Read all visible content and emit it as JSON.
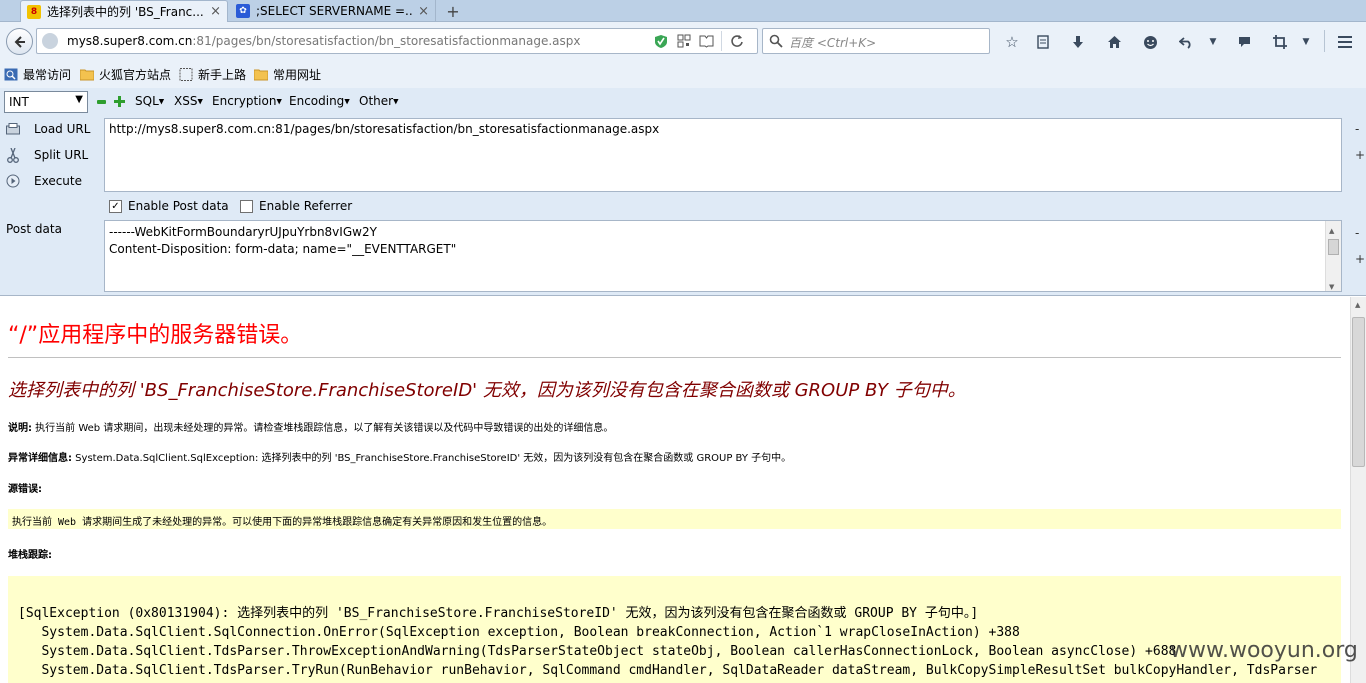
{
  "tabs": [
    {
      "title": "选择列表中的列 'BS_Franc...",
      "close": "×",
      "favicon": "8"
    },
    {
      "title": ";SELECT SERVERNAME =...",
      "close": "×",
      "favicon": "✿"
    }
  ],
  "new_tab": "+",
  "address": {
    "host": "mys8.super8.com.cn",
    "rest": ":81/pages/bn/storesatisfaction/bn_storesatisfactionmanage.aspx"
  },
  "search": {
    "placeholder": "百度 <Ctrl+K>"
  },
  "bookmarks": [
    "最常访问",
    "火狐官方站点",
    "新手上路",
    "常用网址"
  ],
  "hackbar": {
    "type_value": "INT",
    "menus": [
      "SQL",
      "XSS",
      "Encryption",
      "Encoding",
      "Other"
    ],
    "load_url": "Load URL",
    "split_url": "Split URL",
    "execute": "Execute",
    "url_value": "http://mys8.super8.com.cn:81/pages/bn/storesatisfaction/bn_storesatisfactionmanage.aspx",
    "enable_post": "Enable Post data",
    "enable_post_checked": true,
    "enable_referrer": "Enable Referrer",
    "enable_referrer_checked": false,
    "post_label": "Post data",
    "post_lines": [
      "------WebKitFormBoundaryrUJpuYrbn8vIGw2Y",
      "Content-Disposition: form-data; name=\"__EVENTTARGET\""
    ]
  },
  "page": {
    "h1": "“/”应用程序中的服务器错误。",
    "h2": "选择列表中的列 'BS_FranchiseStore.FranchiseStoreID' 无效，因为该列没有包含在聚合函数或 GROUP BY 子句中。",
    "desc_label": "说明:",
    "desc_text": " 执行当前 Web 请求期间，出现未经处理的异常。请检查堆栈跟踪信息，以了解有关该错误以及代码中导致错误的出处的详细信息。",
    "exc_label": "异常详细信息:",
    "exc_text": " System.Data.SqlClient.SqlException: 选择列表中的列 'BS_FranchiseStore.FranchiseStoreID' 无效，因为该列没有包含在聚合函数或 GROUP BY 子句中。",
    "src_label": "源错误:",
    "src_text": "执行当前 Web 请求期间生成了未经处理的异常。可以使用下面的异常堆栈跟踪信息确定有关异常原因和发生位置的信息。",
    "stack_label": "堆栈跟踪:",
    "stack_lines": [
      "[SqlException (0x80131904): 选择列表中的列 'BS_FranchiseStore.FranchiseStoreID' 无效，因为该列没有包含在聚合函数或 GROUP BY 子句中。]",
      "   System.Data.SqlClient.SqlConnection.OnError(SqlException exception, Boolean breakConnection, Action`1 wrapCloseInAction) +388",
      "   System.Data.SqlClient.TdsParser.ThrowExceptionAndWarning(TdsParserStateObject stateObj, Boolean callerHasConnectionLock, Boolean asyncClose) +688",
      "   System.Data.SqlClient.TdsParser.TryRun(RunBehavior runBehavior, SqlCommand cmdHandler, SqlDataReader dataStream, BulkCopySimpleResultSet bulkCopyHandler, TdsParser"
    ]
  },
  "watermark": "www.wooyun.org"
}
